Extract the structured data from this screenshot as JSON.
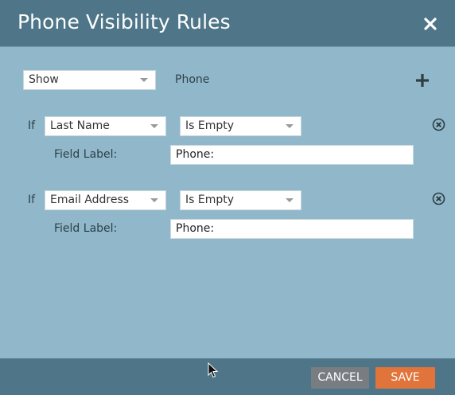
{
  "dialog": {
    "title": "Phone Visibility Rules"
  },
  "visibility": {
    "action_value": "Show",
    "field_name": "Phone"
  },
  "rules": [
    {
      "if_label": "If",
      "field_value": "Last Name",
      "operator_value": "Is Empty",
      "field_label_caption": "Field Label:",
      "field_label_value": "Phone:"
    },
    {
      "if_label": "If",
      "field_value": "Email Address",
      "operator_value": "Is Empty",
      "field_label_caption": "Field Label:",
      "field_label_value": "Phone:"
    }
  ],
  "footer": {
    "cancel_label": "CANCEL",
    "save_label": "SAVE"
  },
  "icons": {
    "close": "close-icon",
    "add": "plus-icon",
    "remove": "remove-circle-icon",
    "dropdown": "chevron-down-icon",
    "cursor": "mouse-pointer-icon"
  },
  "colors": {
    "header": "#4f7688",
    "body": "#90b8ca",
    "save": "#e0743a",
    "cancel": "#777d80"
  }
}
